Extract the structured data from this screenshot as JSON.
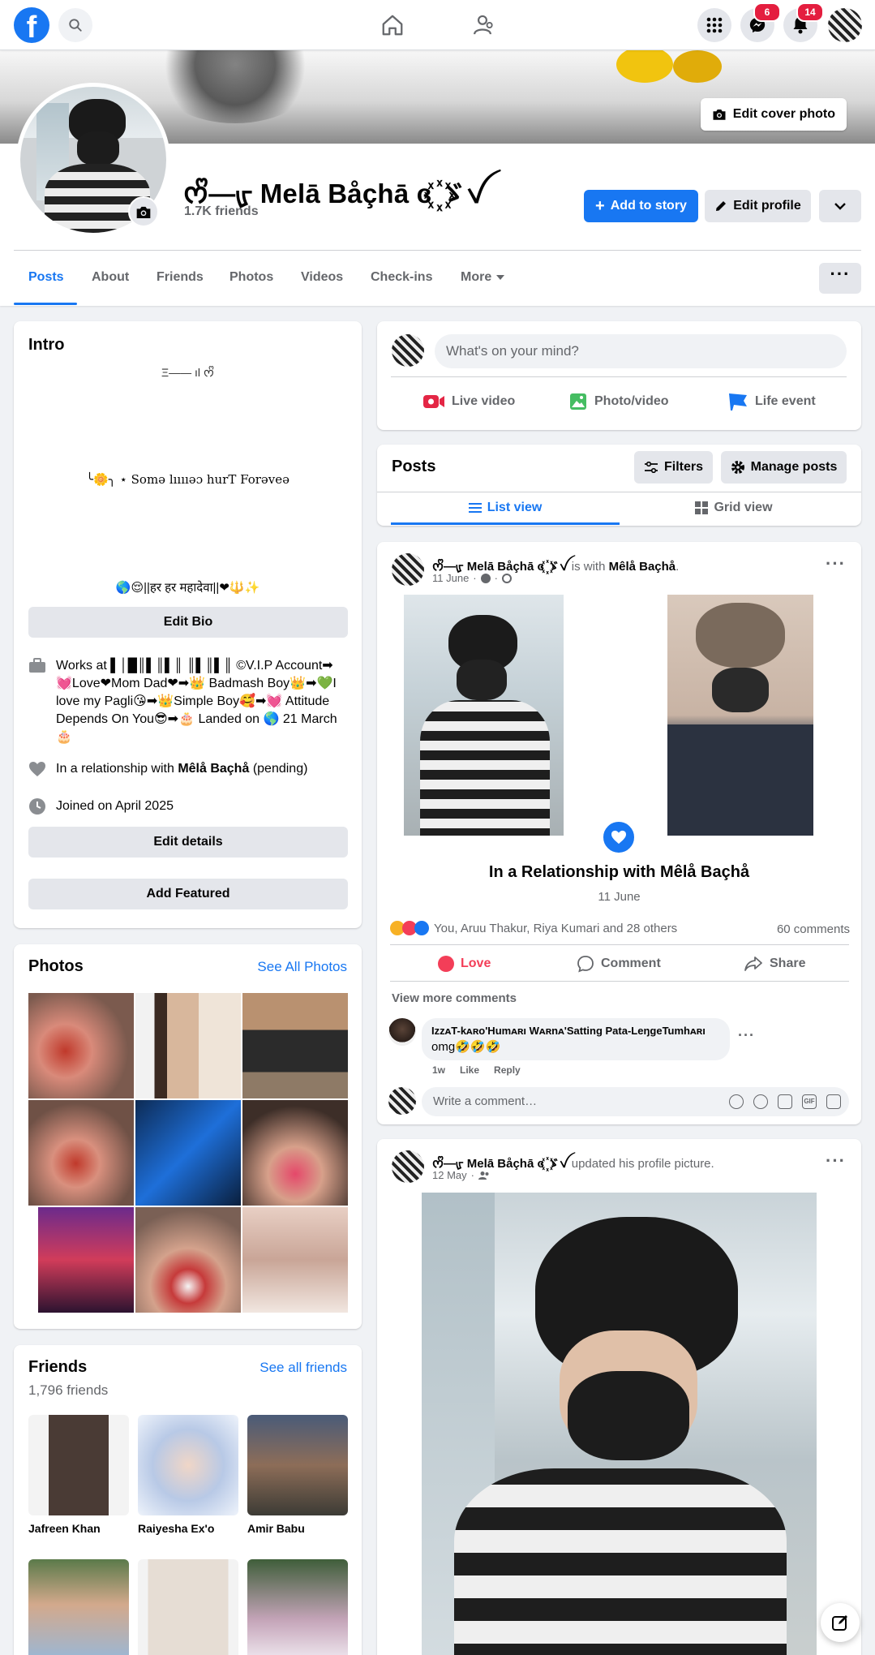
{
  "nav": {
    "notifications_count": "14",
    "messenger_count": "6"
  },
  "header": {
    "edit_cover_label": "Edit cover photo",
    "profile_name": "ᰔᩚ—ᡁ Melā Båçhā ɞ ꙰ゞꪜ",
    "friends_count": "1.7K friends",
    "add_story_label": "Add to story",
    "edit_profile_label": "Edit profile"
  },
  "tabs": [
    {
      "label": "Posts"
    },
    {
      "label": "About"
    },
    {
      "label": "Friends"
    },
    {
      "label": "Photos"
    },
    {
      "label": "Videos"
    },
    {
      "label": "Check-ins"
    },
    {
      "label": "More"
    }
  ],
  "intro": {
    "title": "Intro",
    "bio_line1": "Ξ—— ıl ᰔᩚ",
    "bio_line2": "╰🌼╮ ⋆ Somə lııııəɔ hurT Forəveə",
    "bio_line3": "🌎😌||हर हर महादेवा||❤🔱✨",
    "edit_bio_label": "Edit Bio",
    "works_at": "Works at ▌│█║▌║▌║ ║▌║▌║ ©V.I.P Account➡💓Love❤Mom Dad❤➡👑 Badmash Boy👑➡💚I love my Pagli😘➡👑Simple Boy🥰➡💓 Attitude Depends On You😎➡🎂 Landed on 🌎 21 March 🎂",
    "relationship_prefix": "In a relationship with",
    "relationship_name": "Mêlå Baçhå",
    "relationship_suffix": "(pending)",
    "joined": "Joined on April 2025",
    "edit_details_label": "Edit details",
    "add_featured_label": "Add Featured"
  },
  "photos": {
    "title": "Photos",
    "see_all": "See All Photos"
  },
  "friends": {
    "title": "Friends",
    "see_all": "See all friends",
    "count": "1,796 friends",
    "items": [
      {
        "name": "Jafreen Khan"
      },
      {
        "name": "Raiyesha Ex'o"
      },
      {
        "name": "Amir Babu"
      }
    ]
  },
  "composer": {
    "placeholder": "What's on your mind?",
    "live_video": "Live video",
    "photo_video": "Photo/video",
    "life_event": "Life event"
  },
  "posts_header": {
    "title": "Posts",
    "filters": "Filters",
    "manage": "Manage posts",
    "list_view": "List view",
    "grid_view": "Grid view"
  },
  "post1": {
    "author": "ᰔᩚ—ᡁ Melā Båçhā ɞ ꙰ゞꪜ",
    "is_with": "is with",
    "with_name": "Mêlå Baçhå",
    "date": "11 June",
    "life_event_title": "In a Relationship with Mêlå Baçhå",
    "life_event_date": "11 June",
    "reactions_text": "You, Aruu Thakur, Riya Kumari and 28 others",
    "comments_count": "60 comments",
    "love_label": "Love",
    "comment_label": "Comment",
    "share_label": "Share",
    "view_more": "View more comments",
    "comment_author": "IzzᴀT-kᴀʀo'Humᴀʀı Wᴀʀnᴀ'Satting Pata-LeŋgeTumhᴀʀı",
    "comment_text": "omg🤣🤣🤣",
    "comment_time": "1w",
    "comment_like": "Like",
    "comment_reply": "Reply",
    "write_placeholder": "Write a comment…"
  },
  "post2": {
    "author": "ᰔᩚ—ᡁ Melā Båçhā ɞ ꙰ゞꪜ",
    "action": "updated his profile picture.",
    "date": "12 May"
  }
}
